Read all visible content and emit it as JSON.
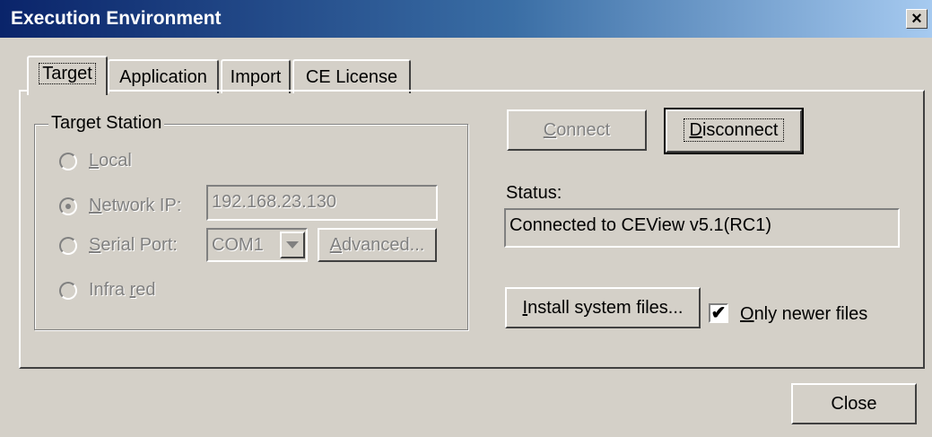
{
  "window": {
    "title": "Execution Environment",
    "close_glyph": "×"
  },
  "tabs": [
    {
      "label": "Target",
      "active": true
    },
    {
      "label": "Application",
      "active": false
    },
    {
      "label": "Import",
      "active": false
    },
    {
      "label": "CE License",
      "active": false
    }
  ],
  "target_station": {
    "group_label": "Target Station",
    "local": {
      "label_u": "L",
      "label_rest": "ocal",
      "checked": false
    },
    "network": {
      "label_u": "N",
      "label_rest": "etwork IP:",
      "checked": true,
      "value": "192.168.23.130"
    },
    "serial": {
      "label_u": "S",
      "label_rest": "erial Port:",
      "checked": false,
      "port_value": "COM1"
    },
    "advanced": {
      "label_u": "A",
      "label_rest": "dvanced..."
    },
    "infrared": {
      "label_pre": "Infra ",
      "label_u": "r",
      "label_rest": "ed",
      "checked": false
    }
  },
  "connection": {
    "connect": {
      "label_u": "C",
      "label_rest": "onnect"
    },
    "disconnect": {
      "label_u": "D",
      "label_rest": "isconnect"
    },
    "status_label": "Status:",
    "status_value": "Connected to CEView v5.1(RC1)"
  },
  "install": {
    "button": {
      "label_u": "I",
      "label_rest": "nstall system files..."
    },
    "only_newer": {
      "label_u": "O",
      "label_rest": "nly newer files",
      "checked": true,
      "check_glyph": "✔"
    }
  },
  "footer": {
    "close_label": "Close"
  }
}
